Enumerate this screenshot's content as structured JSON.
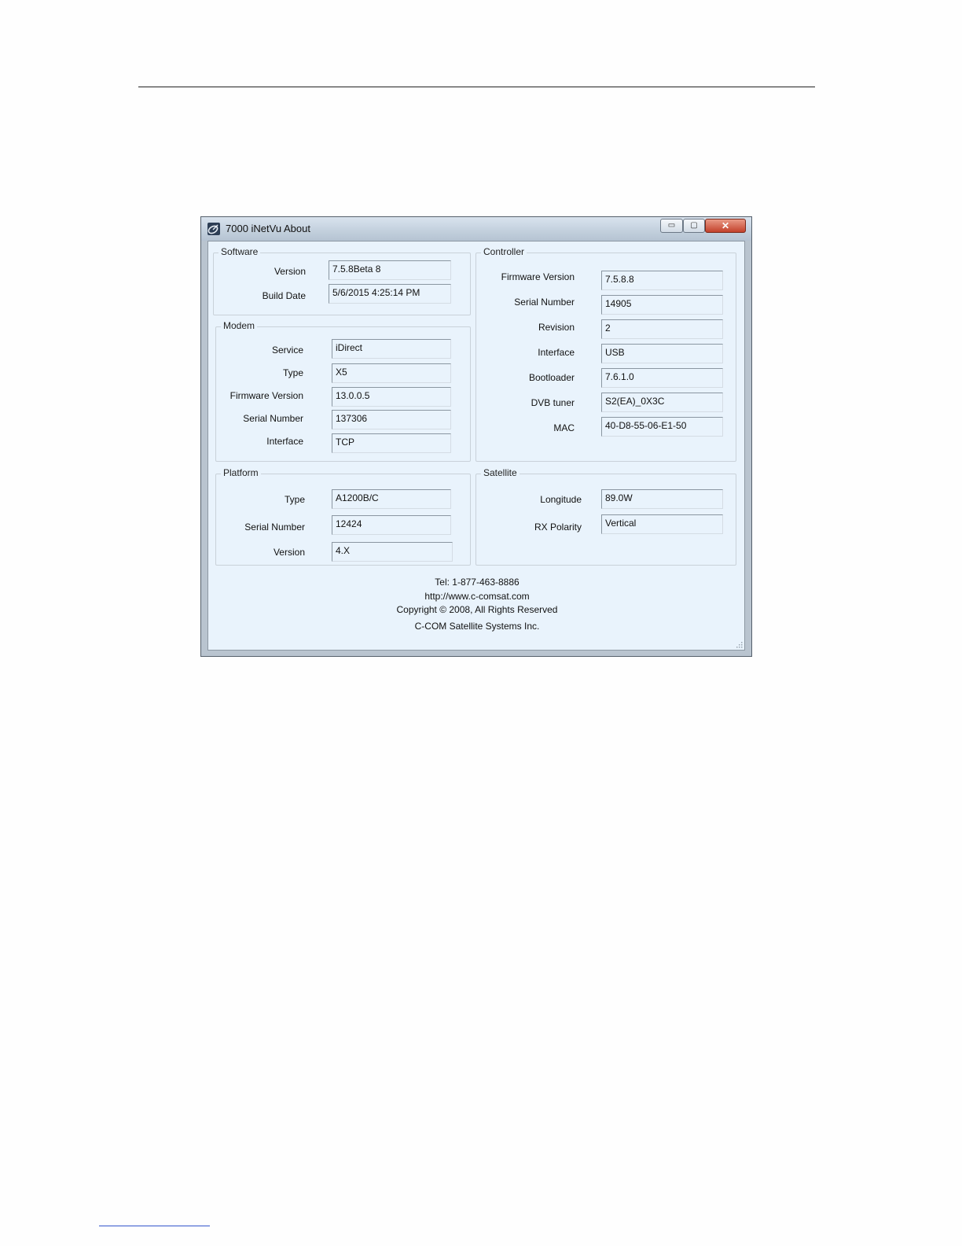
{
  "window": {
    "title": "7000 iNetVu About",
    "minimize_glyph": "▭",
    "maximize_glyph": "▢",
    "close_glyph": "✕"
  },
  "software": {
    "title": "Software",
    "fields": [
      {
        "label": "Version",
        "value": "7.5.8Beta 8"
      },
      {
        "label": "Build Date",
        "value": "5/6/2015 4:25:14 PM"
      }
    ]
  },
  "modem": {
    "title": "Modem",
    "fields": [
      {
        "label": "Service",
        "value": "iDirect"
      },
      {
        "label": "Type",
        "value": "X5"
      },
      {
        "label": "Firmware Version",
        "value": "13.0.0.5"
      },
      {
        "label": "Serial Number",
        "value": "137306"
      },
      {
        "label": "Interface",
        "value": "TCP"
      }
    ]
  },
  "platform": {
    "title": "Platform",
    "fields": [
      {
        "label": "Type",
        "value": "A1200B/C"
      },
      {
        "label": "Serial Number",
        "value": "12424"
      },
      {
        "label": "Version",
        "value": "4.X"
      }
    ]
  },
  "controller": {
    "title": "Controller",
    "fields": [
      {
        "label": "Firmware Version",
        "value": "7.5.8.8"
      },
      {
        "label": "Serial Number",
        "value": "14905"
      },
      {
        "label": "Revision",
        "value": "2"
      },
      {
        "label": "Interface",
        "value": "USB"
      },
      {
        "label": "Bootloader",
        "value": "7.6.1.0"
      },
      {
        "label": "DVB tuner",
        "value": "S2(EA)_0X3C"
      },
      {
        "label": "MAC",
        "value": "40-D8-55-06-E1-50"
      }
    ]
  },
  "satellite": {
    "title": "Satellite",
    "fields": [
      {
        "label": "Longitude",
        "value": "89.0W"
      },
      {
        "label": "RX Polarity",
        "value": "Vertical"
      }
    ]
  },
  "footer": {
    "tel": "Tel: 1-877-463-8886",
    "url": "http://www.c-comsat.com",
    "copyright": "Copyright © 2008, All Rights Reserved",
    "company": "C-COM Satellite Systems Inc."
  },
  "icons": {
    "app": "satellite-dish-icon",
    "resize": "resize-grip-icon"
  }
}
